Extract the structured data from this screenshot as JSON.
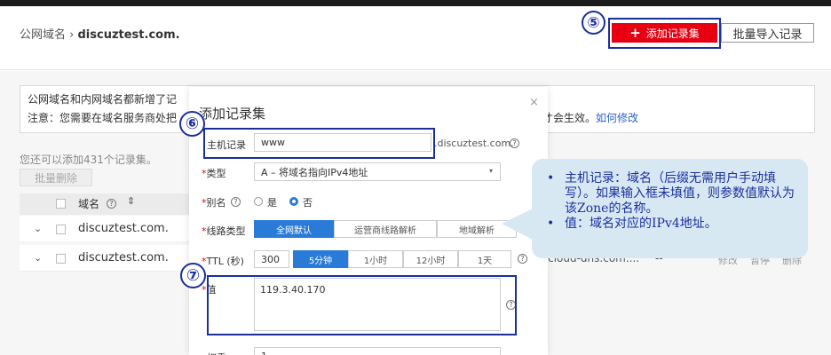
{
  "header": {
    "breadcrumb_root": "公网域名",
    "breadcrumb_sep": "›",
    "breadcrumb_current": "discuztest.com.",
    "add_button_icon": "plus-icon",
    "add_button_label": "添加记录集",
    "import_button_label": "批量导入记录"
  },
  "notice": {
    "line1": "公网域名和内网域名都新增了记",
    "line2": "注意：您需要在域名服务商处",
    "line2_tail": "把",
    "right_text": "才会生效。",
    "right_link": "如何修改"
  },
  "list": {
    "quota_text": "您还可以添加431个记录集。",
    "batch_delete_label": "批量删除",
    "col_domain": "域名",
    "sort_icon": "⇕",
    "rows": [
      {
        "domain": "discuztest.com."
      },
      {
        "domain": "discuztest.com."
      }
    ],
    "row2_tail_value": "vcloud-dns.com....",
    "row2_tail_dash": "--",
    "row2_actions": [
      "修改",
      "暂停",
      "删除"
    ]
  },
  "modal": {
    "title": "添加记录集",
    "close": "×",
    "host_label": "主机记录",
    "host_value": "www",
    "host_suffix": ".discuztest.com.",
    "type_label": "类型",
    "type_value": "A – 将域名指向IPv4地址",
    "alias_label": "别名",
    "alias_yes": "是",
    "alias_no": "否",
    "line_label": "线路类型",
    "line_options": [
      "全网默认",
      "运营商线路解析",
      "地域解析"
    ],
    "ttl_label": "TTL (秒)",
    "ttl_value": "300",
    "ttl_options": [
      "5分钟",
      "1小时",
      "12小时",
      "1天"
    ],
    "value_label": "值",
    "value_text": "119.3.40.170",
    "weight_label": "权重",
    "weight_value": "1"
  },
  "annotations": {
    "five": "⑤",
    "six": "⑥",
    "seven": "⑦"
  },
  "callout": {
    "items": [
      "主机记录：域名（后缀无需用户手动填写）。如果输入框未填值，则参数值默认为该Zone的名称。",
      "值：域名对应的IPv4地址。"
    ],
    "bullet": "•"
  },
  "colors": {
    "brand_red": "#e60012",
    "annotation_blue": "#1a2f9e",
    "selected_blue": "#2a7bd8",
    "link_blue": "#2a62c9"
  }
}
